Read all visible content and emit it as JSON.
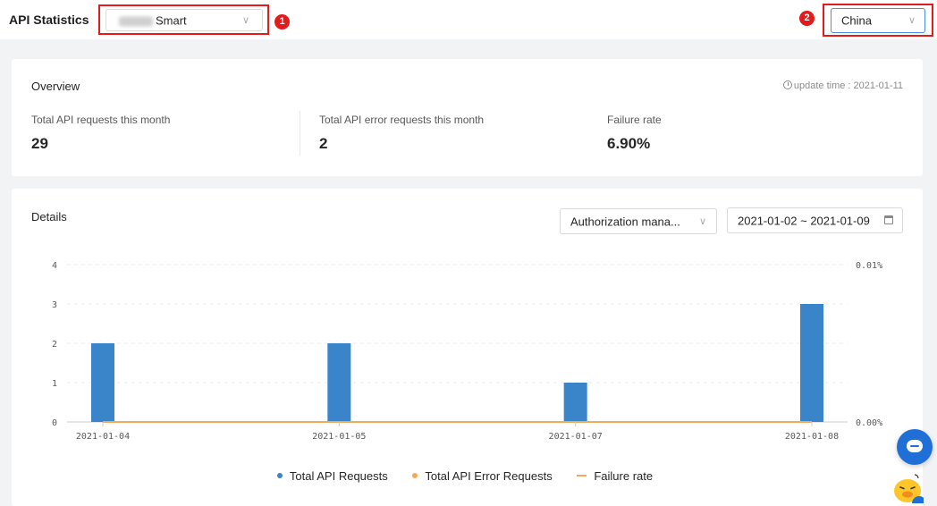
{
  "header": {
    "title": "API Statistics",
    "app_select": {
      "value": "Smart"
    },
    "region_select": {
      "value": "China"
    },
    "annotations": [
      "1",
      "2"
    ]
  },
  "overview": {
    "title": "Overview",
    "update_time": "update time : 2021-01-11",
    "stats": [
      {
        "label": "Total API requests this month",
        "value": "29"
      },
      {
        "label": "Total API error requests this month",
        "value": "2"
      },
      {
        "label": "Failure rate",
        "value": "6.90%"
      }
    ]
  },
  "details": {
    "title": "Details",
    "api_select": {
      "value": "Authorization mana..."
    },
    "date_range": "2021-01-02 ~ 2021-01-09"
  },
  "chart_data": {
    "type": "bar",
    "categories": [
      "2021-01-04",
      "2021-01-05",
      "2021-01-07",
      "2021-01-08"
    ],
    "series": [
      {
        "name": "Total API Requests",
        "values": [
          2,
          2,
          1,
          3
        ],
        "color": "#3a84c9"
      },
      {
        "name": "Total API Error Requests",
        "values": [
          0,
          0,
          0,
          0
        ],
        "color": "#f5a95b"
      },
      {
        "name": "Failure rate",
        "values": [
          0,
          0,
          0,
          0
        ],
        "color": "#f5a95b",
        "axis": "right"
      }
    ],
    "left_axis": {
      "ticks": [
        "0",
        "1",
        "2",
        "3",
        "4"
      ],
      "ylim": [
        0,
        4
      ]
    },
    "right_axis": {
      "ticks": [
        "0.00%",
        "0.01%"
      ]
    },
    "grid": true,
    "legend_position": "bottom"
  },
  "legend": [
    {
      "label": "Total API Requests",
      "color": "#3a84c9",
      "marker": "dot"
    },
    {
      "label": "Total API Error Requests",
      "color": "#f5a95b",
      "marker": "dot"
    },
    {
      "label": "Failure rate",
      "color": "#f5a95b",
      "marker": "line"
    }
  ],
  "widgets": {
    "chat_icon": "chat-bubble-icon",
    "mascot_icon": "duck-mascot-icon"
  }
}
